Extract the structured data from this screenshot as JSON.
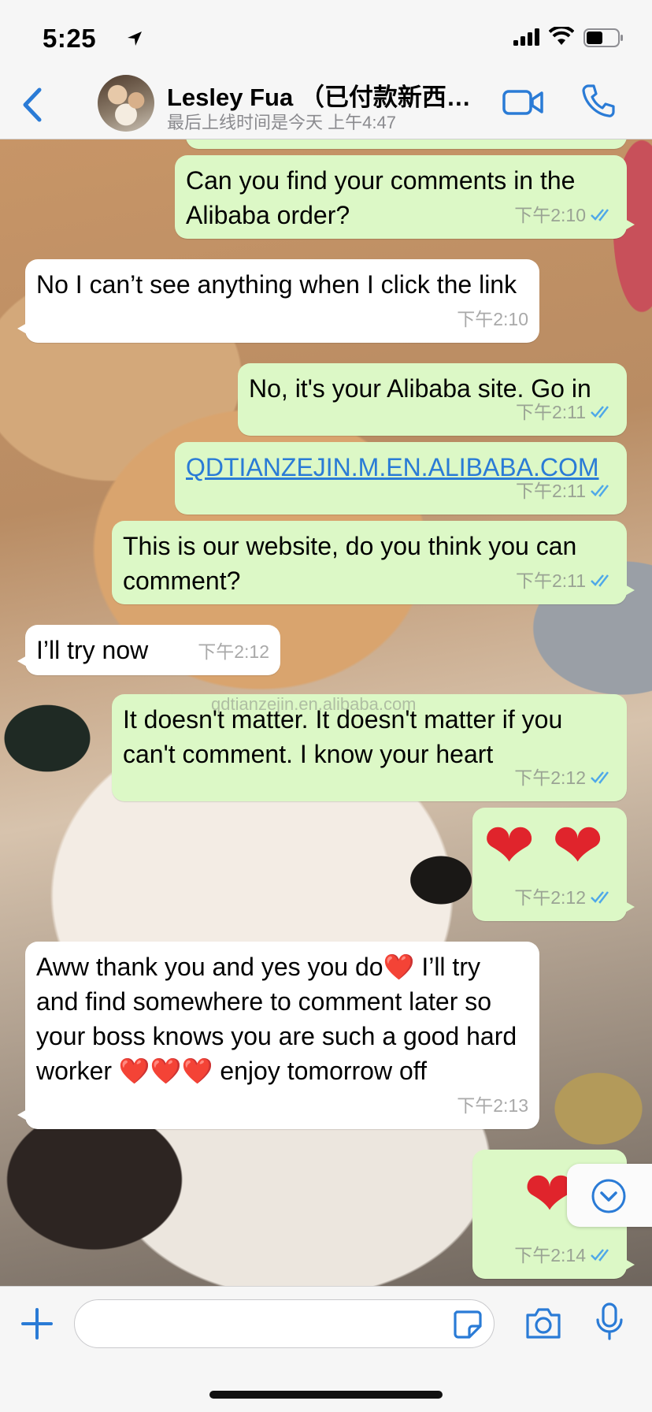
{
  "status_bar": {
    "time": "5:25"
  },
  "header": {
    "contact_name": "Lesley Fua （已付款新西…",
    "last_seen": "最后上线时间是今天 上午4:47"
  },
  "messages": [
    {
      "dir": "out",
      "text": "Can you find your comments in the Alibaba order?",
      "time": "下午2:10"
    },
    {
      "dir": "in",
      "text": "No I can’t see anything when I click the link",
      "time": "下午2:10"
    },
    {
      "dir": "out",
      "text": "No, it's your Alibaba site. Go in",
      "time": "下午2:11"
    },
    {
      "dir": "out",
      "text": "QDTIANZEJIN.M.EN.ALIBABA.COM",
      "time": "下午2:11",
      "link": true
    },
    {
      "dir": "out",
      "text": "This is our website, do you think you can comment?",
      "time": "下午2:11"
    },
    {
      "dir": "in",
      "text": "I’ll try now",
      "time": "下午2:12"
    },
    {
      "dir": "out",
      "text": "It doesn't matter. It doesn't matter if you can't comment. I know your heart",
      "time": "下午2:12"
    },
    {
      "dir": "out",
      "text": "❤ ❤",
      "time": "下午2:12",
      "emoji": true
    },
    {
      "dir": "in",
      "text": "Aww thank you and yes you do❤️ I’ll try and find somewhere to comment later so your boss knows you are such a good hard worker ❤️❤️❤️ enjoy tomorrow off",
      "time": "下午2:13"
    },
    {
      "dir": "out",
      "text": "❤",
      "time": "下午2:14",
      "emoji": true
    }
  ],
  "watermark": "qdtianzejin.en.alibaba.com",
  "composer": {
    "placeholder": ""
  },
  "colors": {
    "accent": "#2a7bd6",
    "outgoing_bubble": "#dcf8c6",
    "incoming_bubble": "#ffffff",
    "heart": "#e0242c"
  }
}
